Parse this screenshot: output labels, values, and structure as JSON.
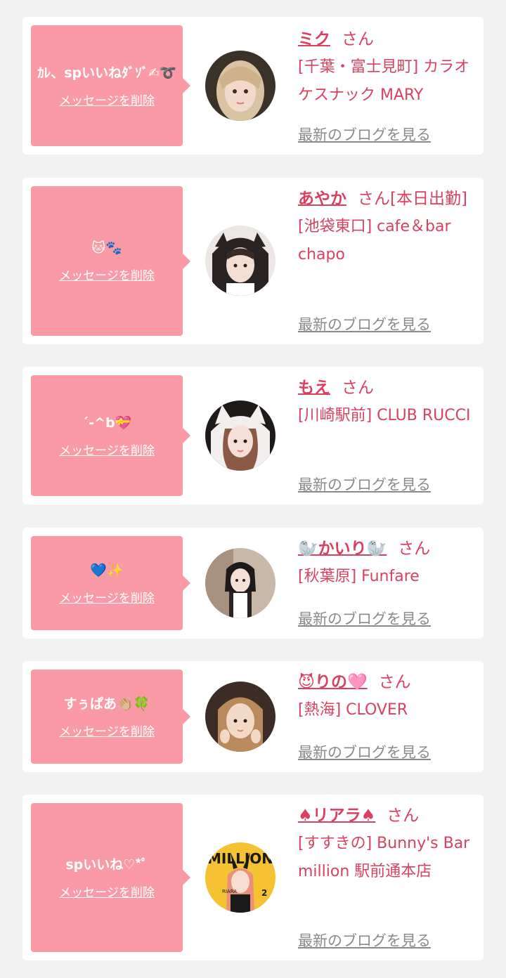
{
  "common": {
    "delete_label": "メッセージを削除",
    "blog_label": "最新のブログを見る",
    "honorific": "さん"
  },
  "colors": {
    "page_bg": "#f2f2f2",
    "bubble_bg": "#f99aa6",
    "accent_pink": "#d9415f",
    "link_gray": "#8a8a8a"
  },
  "cards": [
    {
      "message": "ｶﾚ、spいいねﾀﾞｿﾞ",
      "message_emoji": "✍➰",
      "name": "ミク",
      "name_suffix": "さん",
      "shop": "[千葉・富士見町] カラオケスナック MARY"
    },
    {
      "message": "",
      "message_emoji": "🐱🐾",
      "name": "あやか",
      "name_suffix": "さん[本日出勤]",
      "shop": "[池袋東口] cafe＆bar chapo"
    },
    {
      "message": "ˊ-^b",
      "message_emoji": "💝",
      "name": "もえ",
      "name_suffix": "さん",
      "shop": "[川崎駅前] CLUB RUCCI"
    },
    {
      "message": "",
      "message_emoji": "💙✨",
      "name": "🦭かいり🦭",
      "name_suffix": "さん",
      "shop": "[秋葉原] Funfare"
    },
    {
      "message": "すぅぱあ",
      "message_emoji": "👏🏼🍀",
      "name": "😈りの🩷",
      "name_suffix": "さん",
      "shop": "[熱海] CLOVER"
    },
    {
      "message": "spいいね♡*ﾟ",
      "message_emoji": "",
      "name": "♠リアラ♠",
      "name_suffix": "さん",
      "shop": "[すすきの] Bunny's Bar million 駅前通本店"
    }
  ],
  "avatar_text": {
    "card6_poster_title": "MILLION",
    "card6_poster_name": "RIARA",
    "card6_poster_number": "2"
  }
}
